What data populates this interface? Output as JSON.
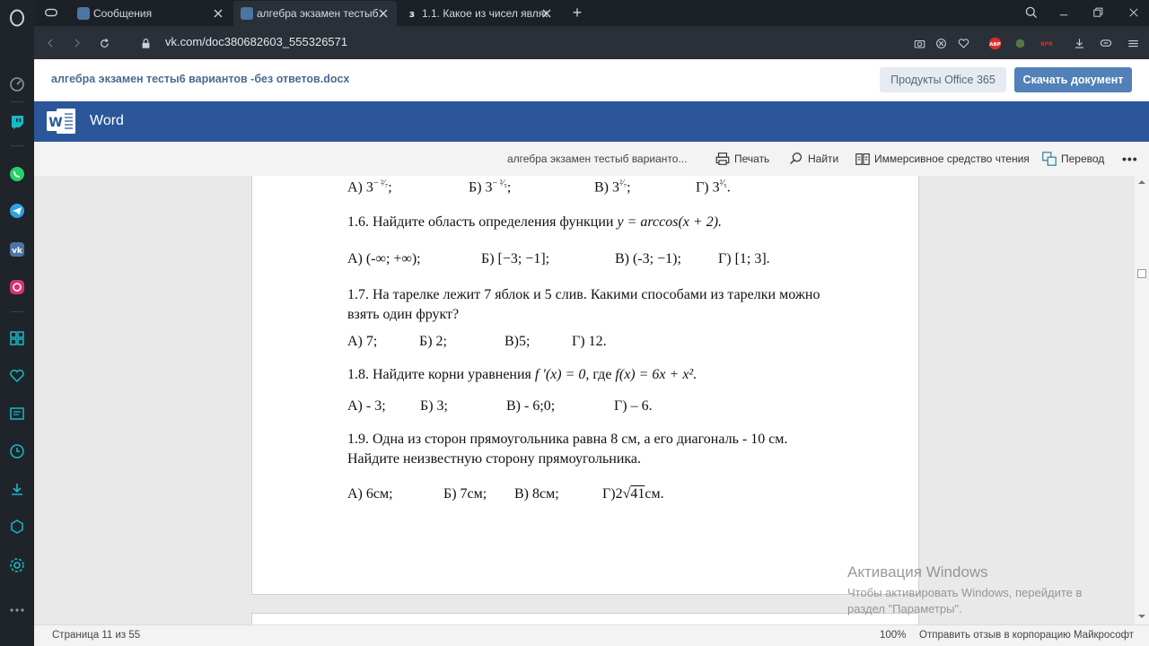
{
  "browser": {
    "tabs": [
      {
        "title": "Сообщения"
      },
      {
        "title": "алгебра экзамен тестыб в..."
      },
      {
        "title": "1.1. Какое из чисел являе..."
      }
    ],
    "url": "vk.com/doc380682603_555326571",
    "new_tab_label": "+"
  },
  "vk": {
    "doc_name": "алгебра экзамен тесты6 вариантов -без ответов.docx",
    "office_button": "Продукты Office 365",
    "download_button": "Скачать документ"
  },
  "word": {
    "app_title": "Word",
    "toolbar": {
      "doc_name": "алгебра экзамен тестыб варианто...",
      "print": "Печать",
      "find": "Найти",
      "immersive": "Иммерсивное средство чтения",
      "translate": "Перевод",
      "more": "•••"
    }
  },
  "document": {
    "q15_options": {
      "a": "А) 3",
      "a_exp": "− ²⁄₇",
      "a_end": ";",
      "b": "Б) 3",
      "b_exp": "− ²⁄₅",
      "b_end": ";",
      "c": "В) 3",
      "c_exp": "²⁄₇",
      "c_end": ";",
      "d": "Г) 3",
      "d_exp": "²⁄₅",
      "d_end": "."
    },
    "q16": {
      "text": "1.6. Найдите область определения функции",
      "formula": "y = arccos(x + 2)."
    },
    "q16_options": {
      "a": "А) (-∞; +∞);",
      "b": "Б) [−3; −1];",
      "c": "В) (-3; −1);",
      "d": "Г) [1; 3]."
    },
    "q17": {
      "line1": "1.7. На тарелке лежит 7 яблок и 5 слив. Какими способами из тарелки можно",
      "line2": "взять один фрукт?"
    },
    "q17_options": {
      "a": "А) 7;",
      "b": "Б) 2;",
      "c": "В)5;",
      "d": "Г) 12."
    },
    "q18": {
      "text": "1.8. Найдите корни уравнения",
      "formula1": "f ′(x) = 0,",
      "mid": "где",
      "formula2": "f(x) = 6x + x².",
      "superscript_note": ""
    },
    "q18_options": {
      "a": "А) - 3;",
      "b": "Б) 3;",
      "c": "В) - 6;0;",
      "d": "Г) – 6."
    },
    "q19": {
      "line1": "1.9. Одна из сторон прямоугольника равна 8 см, а его диагональ - 10 см.",
      "line2": "Найдите неизвестную сторону прямоугольника."
    },
    "q19_options": {
      "a": "А) 6см;",
      "b": "Б) 7см;",
      "c": "В) 8см;",
      "d_pre": "Г)2",
      "d_root": "41",
      "d_post": "см."
    }
  },
  "status": {
    "page": "Страница 11 из 55",
    "zoom": "100%",
    "feedback": "Отправить отзыв в корпорацию Майкрософт"
  },
  "watermark": {
    "title": "Активация Windows",
    "text": "Чтобы активировать Windows, перейдите в раздел \"Параметры\"."
  }
}
